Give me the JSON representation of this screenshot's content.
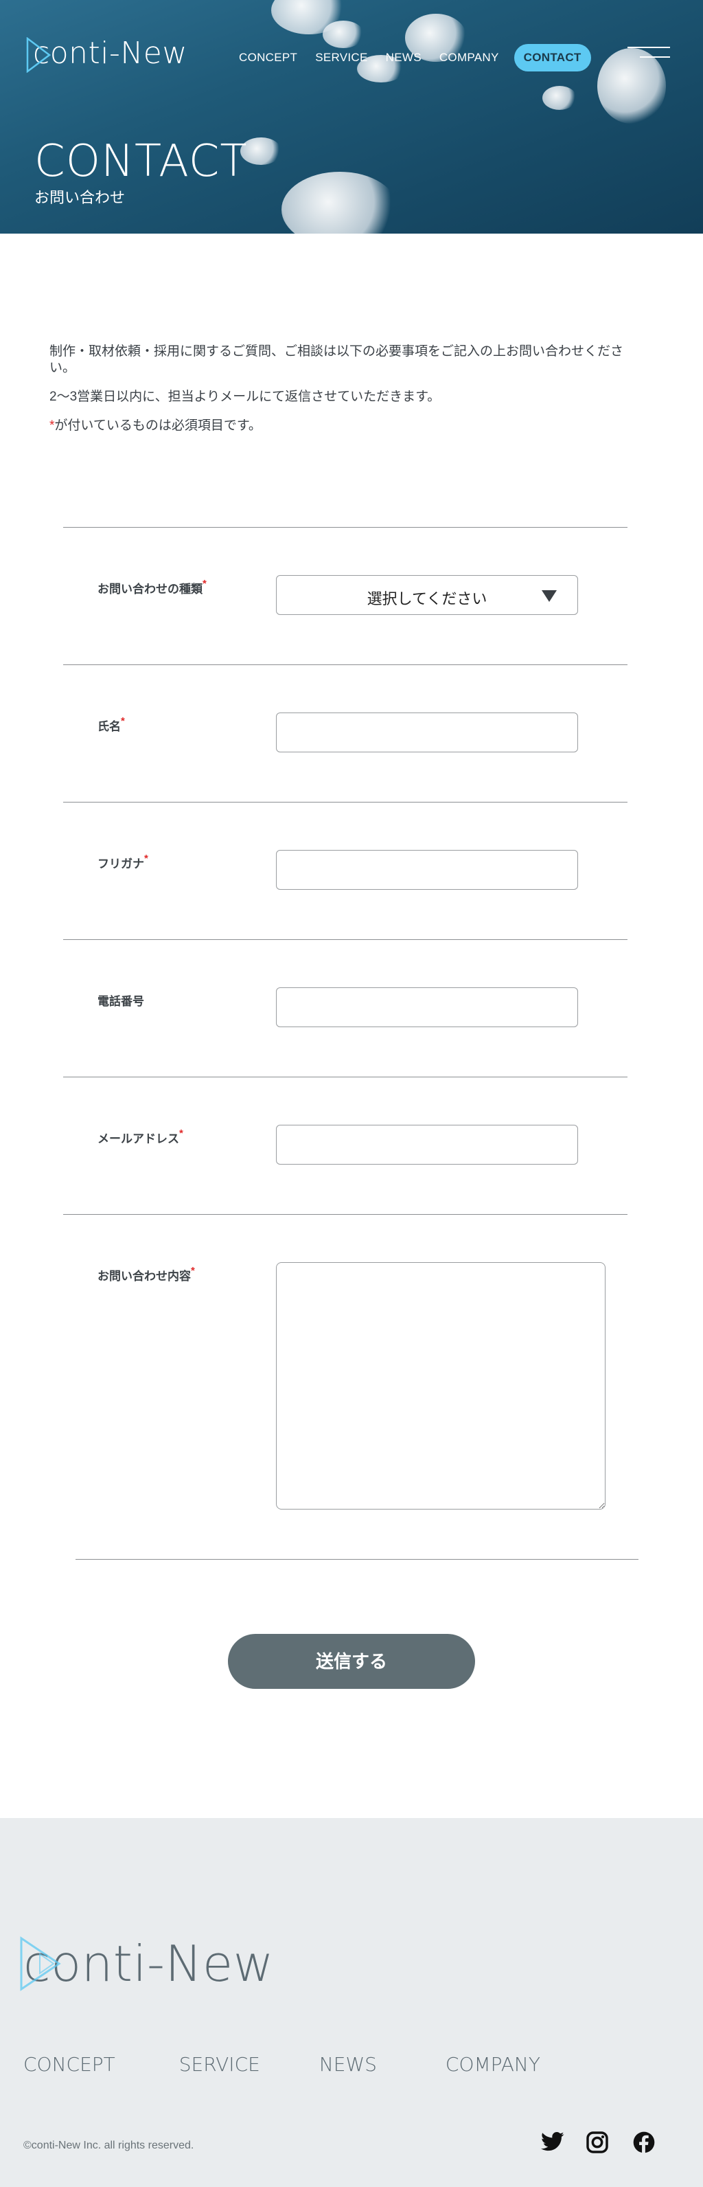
{
  "header": {
    "logo_text": "conti-New",
    "nav": [
      "CONCEPT",
      "SERVICE",
      "NEWS",
      "COMPANY"
    ],
    "contact_label": "CONTACT",
    "menu_icon": "hamburger-icon"
  },
  "hero": {
    "title": "CONTACT",
    "subtitle": "お問い合わせ"
  },
  "intro": {
    "line1": "制作・取材依頼・採用に関するご質問、ご相談は以下の必要事項をご記入の上お問い合わせください。",
    "line2": "2〜3営業日以内に、担当よりメールにて返信させていただきます。",
    "required_mark": "*",
    "line3": "が付いているものは必須項目です。"
  },
  "form": {
    "required_mark": "*",
    "fields": [
      {
        "label": "お問い合わせの種類",
        "required": true,
        "type": "select",
        "value": "選択してください"
      },
      {
        "label": "氏名",
        "required": true,
        "type": "text",
        "value": ""
      },
      {
        "label": "フリガナ",
        "required": true,
        "type": "text",
        "value": ""
      },
      {
        "label": "電話番号",
        "required": false,
        "type": "text",
        "value": ""
      },
      {
        "label": "メールアドレス",
        "required": true,
        "type": "text",
        "value": ""
      },
      {
        "label": "お問い合わせ内容",
        "required": true,
        "type": "textarea",
        "value": ""
      }
    ],
    "submit_label": "送信する"
  },
  "footer": {
    "logo_text": "conti-New",
    "nav": [
      "CONCEPT",
      "SERVICE",
      "NEWS",
      "COMPANY"
    ],
    "copyright": "©conti-New Inc. all rights reserved.",
    "social": [
      "twitter-icon",
      "instagram-icon",
      "facebook-icon"
    ]
  },
  "colors": {
    "accent": "#5dc9f2",
    "required": "#e02a2a",
    "button": "#5f6e74",
    "footer_bg": "#e9ecee",
    "footer_text": "#5d6b73"
  }
}
